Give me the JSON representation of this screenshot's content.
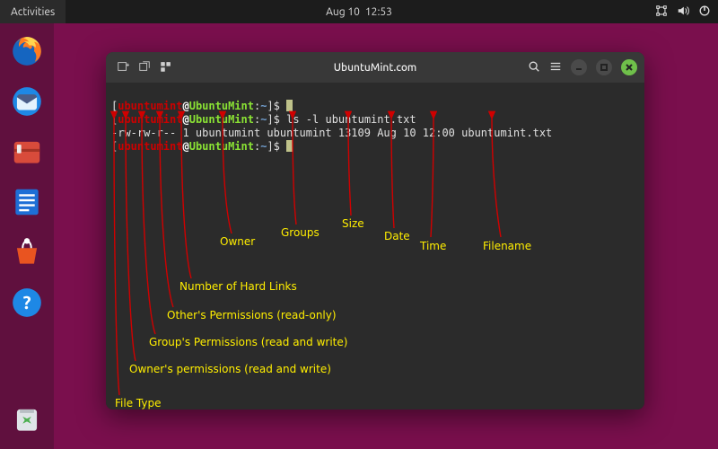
{
  "topbar": {
    "activities": "Activities",
    "date": "Aug 10",
    "time": "12:53"
  },
  "dock": {
    "items": [
      {
        "name": "firefox"
      },
      {
        "name": "thunderbird"
      },
      {
        "name": "files"
      },
      {
        "name": "writer"
      },
      {
        "name": "software"
      },
      {
        "name": "help"
      },
      {
        "name": "trash"
      }
    ]
  },
  "terminal": {
    "title": "UbuntuMint.com",
    "prompt": {
      "user": "ubuntumint",
      "at": "@",
      "host": "UbuntuMint",
      "colon": ":",
      "cwd": "~",
      "end": "]$"
    },
    "lines": {
      "cmd1": "",
      "cmd2": "ls -l ubuntumint.txt",
      "output": "-rw-rw-r-- 1 ubuntumint ubuntumint 13109 Aug 10 12:00 ubuntumint.txt"
    }
  },
  "annotations": {
    "filetype": "File Type",
    "owner_perm": "Owner's permissions (read and write)",
    "group_perm": "Group's Permissions (read and write)",
    "other_perm": "Other's Permissions (read-only)",
    "hardlinks": "Number of Hard Links",
    "owner": "Owner",
    "groups": "Groups",
    "size": "Size",
    "date": "Date",
    "time": "Time",
    "filename": "Filename"
  },
  "arrow_color": "#d00000"
}
